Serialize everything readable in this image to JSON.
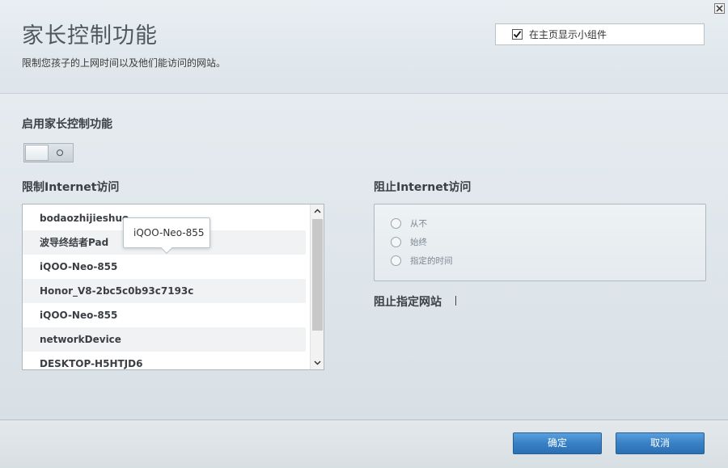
{
  "header": {
    "title": "家长控制功能",
    "subtitle": "限制您孩子的上网时间以及他们能访问的网站。",
    "show_widget_label": "在主页显示小组件",
    "show_widget_checked": true
  },
  "parental_control": {
    "enable_label": "启用家长控制功能",
    "enabled": false
  },
  "restrict_internet": {
    "label": "限制Internet访问",
    "devices": [
      "bodaozhijieshuo",
      "波导终结者Pad",
      "iQOO-Neo-855",
      "Honor_V8-2bc5c0b93c7193c",
      "iQOO-Neo-855",
      "networkDevice",
      "DESKTOP-H5HTJD6"
    ],
    "tooltip": "iQOO-Neo-855"
  },
  "block_internet": {
    "label": "阻止Internet访问",
    "options": [
      "从不",
      "始终",
      "指定的时间"
    ]
  },
  "block_sites": {
    "label": "阻止指定网站"
  },
  "footer": {
    "ok_label": "确定",
    "cancel_label": "取消"
  },
  "colors": {
    "accent_button": "#3880c6",
    "background": "#e3e9ed"
  }
}
